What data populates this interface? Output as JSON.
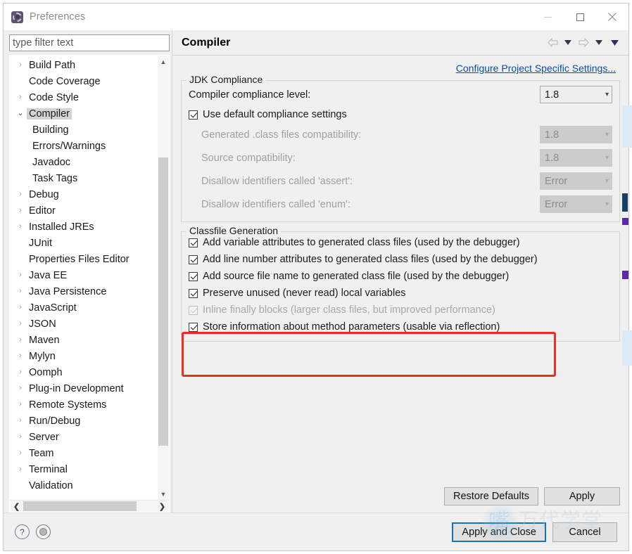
{
  "window": {
    "title": "Preferences",
    "icon": "gear-icon",
    "controls": {
      "minimize": "–",
      "maximize": "□",
      "close": "✕"
    }
  },
  "sidebar": {
    "filter": {
      "placeholder": "type filter text",
      "value": ""
    },
    "items": [
      {
        "label": "Build Path",
        "level": 0,
        "arrow": "right",
        "selected": false
      },
      {
        "label": "Code Coverage",
        "level": 0,
        "arrow": "none",
        "selected": false
      },
      {
        "label": "Code Style",
        "level": 0,
        "arrow": "right",
        "selected": false
      },
      {
        "label": "Compiler",
        "level": 0,
        "arrow": "down",
        "selected": true
      },
      {
        "label": "Building",
        "level": 1,
        "arrow": "none",
        "selected": false
      },
      {
        "label": "Errors/Warnings",
        "level": 1,
        "arrow": "none",
        "selected": false
      },
      {
        "label": "Javadoc",
        "level": 1,
        "arrow": "none",
        "selected": false
      },
      {
        "label": "Task Tags",
        "level": 1,
        "arrow": "none",
        "selected": false
      },
      {
        "label": "Debug",
        "level": 0,
        "arrow": "right",
        "selected": false
      },
      {
        "label": "Editor",
        "level": 0,
        "arrow": "right",
        "selected": false
      },
      {
        "label": "Installed JREs",
        "level": 0,
        "arrow": "right",
        "selected": false
      },
      {
        "label": "JUnit",
        "level": 0,
        "arrow": "none",
        "selected": false
      },
      {
        "label": "Properties Files Editor",
        "level": 0,
        "arrow": "none",
        "selected": false
      },
      {
        "label": "Java EE",
        "level": 0,
        "arrow": "right",
        "selected": false
      },
      {
        "label": "Java Persistence",
        "level": 0,
        "arrow": "right",
        "selected": false
      },
      {
        "label": "JavaScript",
        "level": 0,
        "arrow": "right",
        "selected": false
      },
      {
        "label": "JSON",
        "level": 0,
        "arrow": "right",
        "selected": false
      },
      {
        "label": "Maven",
        "level": 0,
        "arrow": "right",
        "selected": false
      },
      {
        "label": "Mylyn",
        "level": 0,
        "arrow": "right",
        "selected": false
      },
      {
        "label": "Oomph",
        "level": 0,
        "arrow": "right",
        "selected": false
      },
      {
        "label": "Plug-in Development",
        "level": 0,
        "arrow": "right",
        "selected": false
      },
      {
        "label": "Remote Systems",
        "level": 0,
        "arrow": "right",
        "selected": false
      },
      {
        "label": "Run/Debug",
        "level": 0,
        "arrow": "right",
        "selected": false
      },
      {
        "label": "Server",
        "level": 0,
        "arrow": "right",
        "selected": false
      },
      {
        "label": "Team",
        "level": 0,
        "arrow": "right",
        "selected": false
      },
      {
        "label": "Terminal",
        "level": 0,
        "arrow": "right",
        "selected": false
      },
      {
        "label": "Validation",
        "level": 0,
        "arrow": "none",
        "selected": false
      }
    ]
  },
  "page": {
    "title": "Compiler",
    "configure_link": "Configure Project Specific Settings...",
    "nav": {
      "back": "back-arrow",
      "back_menu": "chevron-down-icon",
      "forward": "forward-arrow",
      "forward_menu": "chevron-down-icon",
      "view_menu": "chevron-down-icon"
    },
    "jdk_compliance": {
      "title": "JDK Compliance",
      "compliance_level": {
        "label": "Compiler compliance level:",
        "value": "1.8",
        "enabled": true
      },
      "use_defaults": {
        "label": "Use default compliance settings",
        "checked": true,
        "enabled": true
      },
      "rows": [
        {
          "label": "Generated .class files compatibility:",
          "value": "1.8",
          "enabled": false
        },
        {
          "label": "Source compatibility:",
          "value": "1.8",
          "enabled": false
        },
        {
          "label": "Disallow identifiers called 'assert':",
          "value": "Error",
          "enabled": false
        },
        {
          "label": "Disallow identifiers called 'enum':",
          "value": "Error",
          "enabled": false
        }
      ]
    },
    "classfile_generation": {
      "title": "Classfile Generation",
      "options": [
        {
          "label": "Add variable attributes to generated class files (used by the debugger)",
          "checked": true,
          "enabled": true
        },
        {
          "label": "Add line number attributes to generated class files (used by the debugger)",
          "checked": true,
          "enabled": true
        },
        {
          "label": "Add source file name to generated class file (used by the debugger)",
          "checked": true,
          "enabled": true
        },
        {
          "label": "Preserve unused (never read) local variables",
          "checked": true,
          "enabled": true
        },
        {
          "label": "Inline finally blocks (larger class files, but improved performance)",
          "checked": true,
          "enabled": false
        },
        {
          "label": "Store information about method parameters (usable via reflection)",
          "checked": true,
          "enabled": true
        }
      ]
    },
    "buttons": {
      "restore_defaults": "Restore Defaults",
      "apply": "Apply"
    }
  },
  "footer": {
    "help_icon": "?",
    "pin_icon": "circle-icon",
    "apply_and_close": "Apply and Close",
    "cancel": "Cancel"
  },
  "annotation": {
    "type": "red-rectangle",
    "color": "#ee2d20",
    "targets": "Store information about method parameters (usable via reflection)"
  },
  "watermark": {
    "glyph": "嘴",
    "text": "万代学堂"
  },
  "colors": {
    "accent_link": "#0b4ea2",
    "focus_border": "#1173b8",
    "annotation": "#ee2d20",
    "selection": "#d4d4d4",
    "dialog_bg": "#f0f0f0"
  }
}
